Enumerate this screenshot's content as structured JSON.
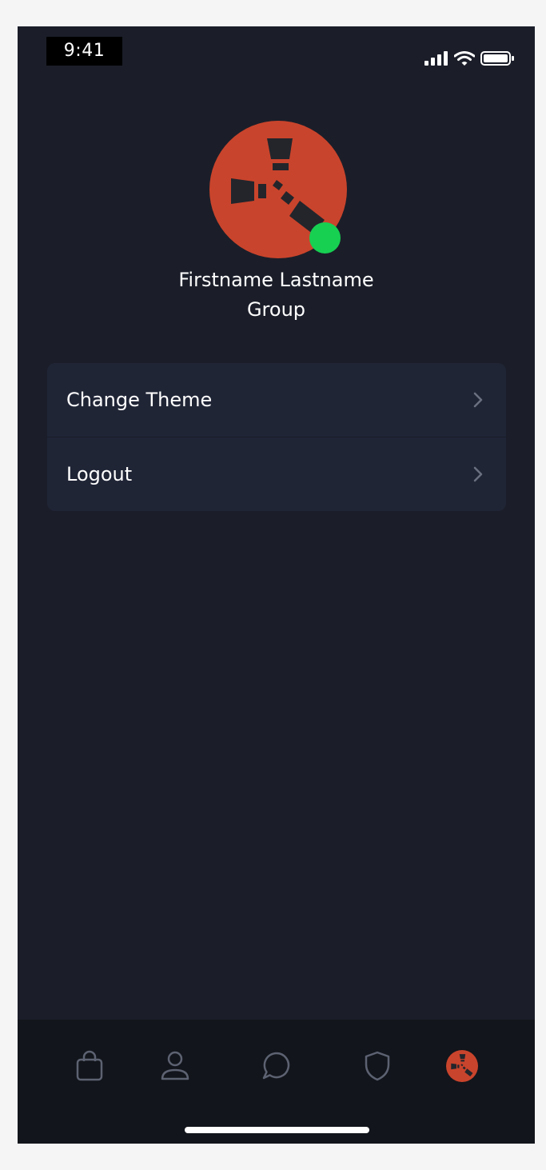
{
  "status_bar": {
    "time": "9:41",
    "icons": [
      "cellular-signal-icon",
      "wifi-icon",
      "battery-icon"
    ]
  },
  "profile": {
    "avatar_icon": "rust-logo-icon",
    "online_status_color": "#17d052",
    "name": "Firstname Lastname",
    "group": "Group"
  },
  "menu": {
    "items": [
      {
        "label": "Change Theme",
        "icon": "chevron-right-icon"
      },
      {
        "label": "Logout",
        "icon": "chevron-right-icon"
      }
    ]
  },
  "tab_bar": {
    "tabs": [
      {
        "icon": "shopping-bag-icon",
        "active": false
      },
      {
        "icon": "user-icon",
        "active": false
      },
      {
        "icon": "chat-bubble-icon",
        "active": false
      },
      {
        "icon": "shield-icon",
        "active": false
      },
      {
        "icon": "rust-logo-icon",
        "active": true
      }
    ]
  },
  "colors": {
    "background": "#1b1e29",
    "card": "#202536",
    "tab_bar": "#12151b",
    "accent": "#c9442c",
    "icon_inactive": "#5d6272",
    "text": "#ffffff"
  }
}
